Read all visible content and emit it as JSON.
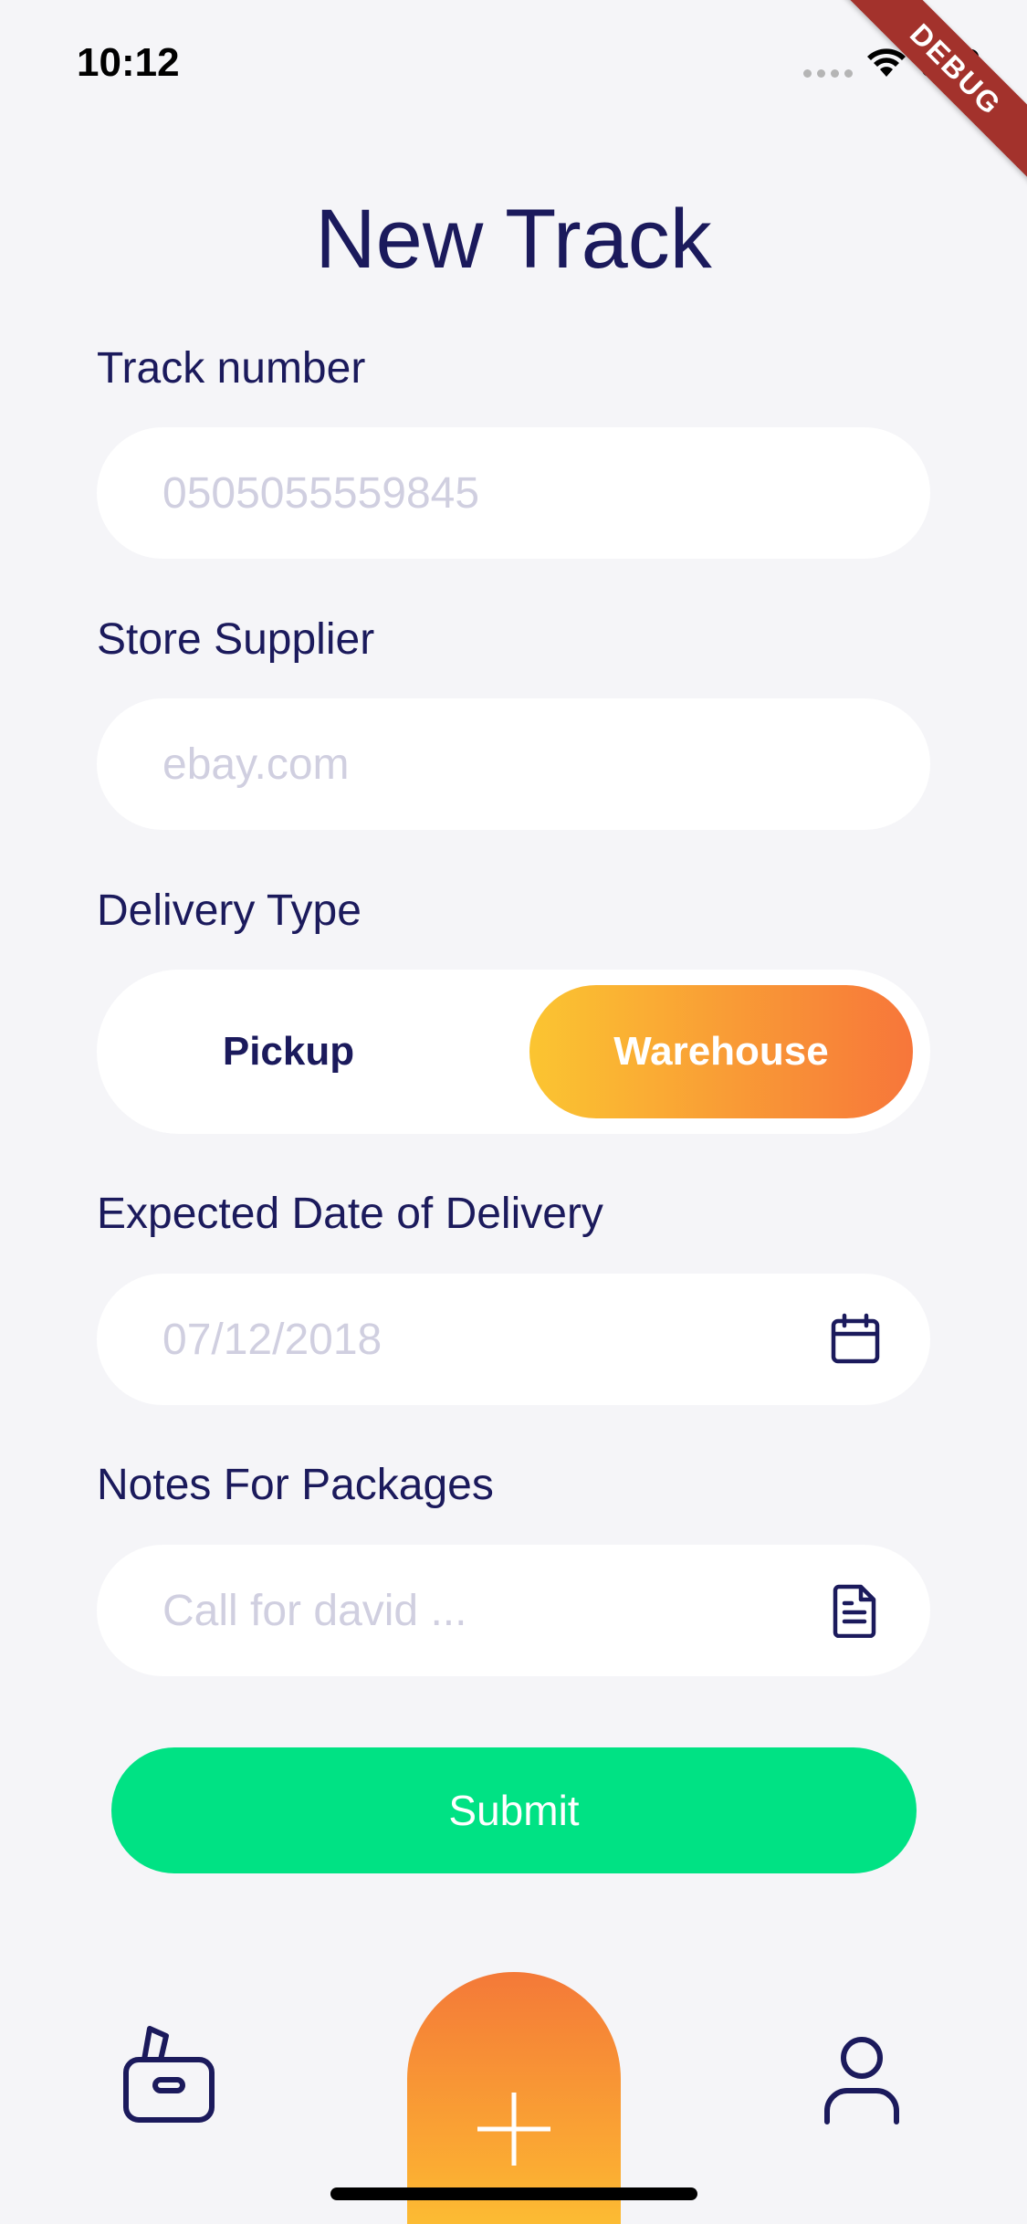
{
  "status_bar": {
    "time": "10:12",
    "debug_label": "DEBUG"
  },
  "page": {
    "title": "New Track"
  },
  "form": {
    "track_number": {
      "label": "Track number",
      "placeholder": "0505055559845"
    },
    "store_supplier": {
      "label": "Store Supplier",
      "placeholder": "ebay.com"
    },
    "delivery_type": {
      "label": "Delivery Type",
      "options": [
        "Pickup",
        "Warehouse"
      ],
      "selected": "Warehouse"
    },
    "expected_date": {
      "label": "Expected Date of Delivery",
      "placeholder": "07/12/2018",
      "icon": "calendar-icon"
    },
    "notes": {
      "label": "Notes For Packages",
      "placeholder": "Call for david ...",
      "icon": "document-icon"
    },
    "submit_label": "Submit"
  },
  "bottom_nav": {
    "items": [
      {
        "icon": "package-icon"
      },
      {
        "icon": "plus-icon"
      },
      {
        "icon": "user-icon"
      }
    ]
  },
  "colors": {
    "primary_text": "#1b1a5c",
    "placeholder": "#d0cfe0",
    "submit": "#00e284",
    "gradient_start": "#fbc531",
    "gradient_end": "#f7763a",
    "background": "#f5f5f8"
  }
}
